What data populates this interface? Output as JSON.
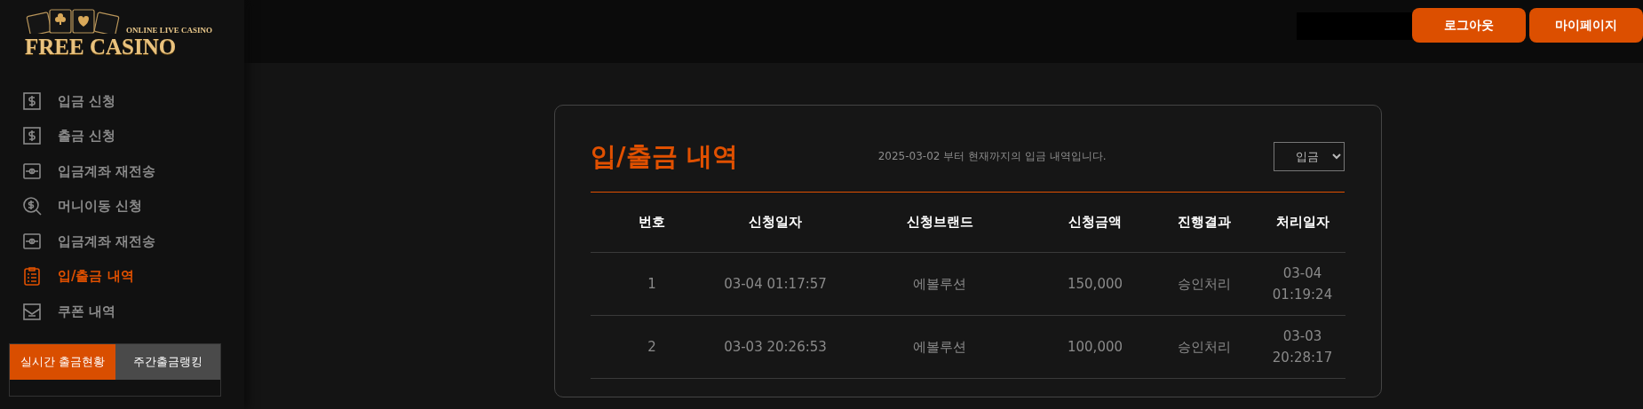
{
  "logo": {
    "tagline": "ONLINE LIVE CASINO",
    "name": "FREE CASINO"
  },
  "sidebar": {
    "items": [
      {
        "label": "입금 신청",
        "selected": false
      },
      {
        "label": "출금 신청",
        "selected": false
      },
      {
        "label": "입금계좌 재전송",
        "selected": false
      },
      {
        "label": "머니이동 신청",
        "selected": false
      },
      {
        "label": "입금계좌 재전송",
        "selected": false
      },
      {
        "label": "입/출금 내역",
        "selected": true
      },
      {
        "label": "쿠폰 내역",
        "selected": false
      }
    ],
    "tabs": [
      {
        "label": "실시간 출금현황",
        "selected": true
      },
      {
        "label": "주간출금랭킹",
        "selected": false
      }
    ]
  },
  "header": {
    "buttons": [
      "로그아웃",
      "마이페이지"
    ]
  },
  "panel": {
    "title": "입/출금 내역",
    "notice": "2025-03-02 부터 현재까지의 입금 내역입니다.",
    "filter": {
      "value": "입금"
    },
    "table": {
      "columns": [
        "번호",
        "신청일자",
        "신청브랜드",
        "신청금액",
        "진행결과",
        "처리일자"
      ],
      "rows": [
        [
          "1",
          "03-04 01:17:57",
          "에볼루션",
          "150,000",
          "승인처리",
          "03-04 01:19:24"
        ],
        [
          "2",
          "03-03 20:26:53",
          "에볼루션",
          "100,000",
          "승인처리",
          "03-03 20:28:17"
        ]
      ]
    }
  }
}
